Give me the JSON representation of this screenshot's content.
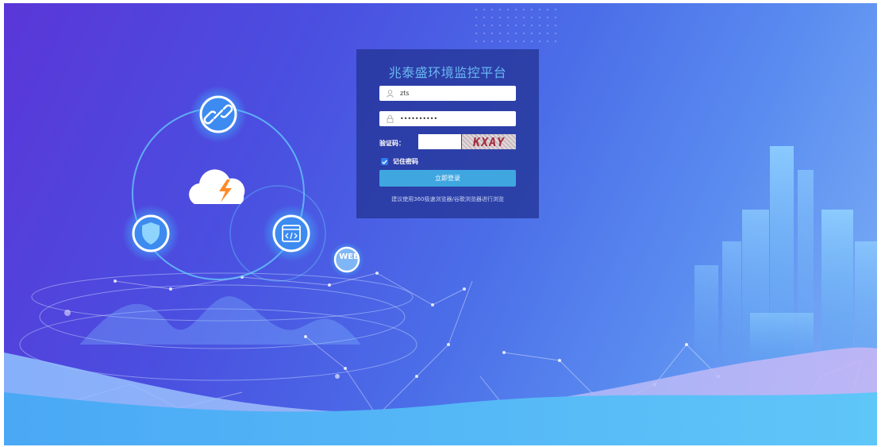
{
  "login": {
    "title": "兆泰盛环境监控平台",
    "username_value": "zts",
    "password_value": "••••••••••",
    "captcha_label": "验证码：",
    "captcha_value": "",
    "captcha_text": "KXAY",
    "remember_label": "记住密码",
    "remember_checked": true,
    "submit_label": "立即登录",
    "browser_hint": "建议使用360极速浏览器/谷歌浏览器进行浏览"
  },
  "illustration": {
    "web_badge": "WEB",
    "icons": [
      "link-icon",
      "cloud-lightning-icon",
      "shield-icon",
      "code-window-icon"
    ]
  },
  "colors": {
    "panel": "#2434962b",
    "title": "#69b8f2",
    "button": "#3fa6e0",
    "checkbox": "#2a7df0",
    "captcha_text": "#a22a3c"
  }
}
